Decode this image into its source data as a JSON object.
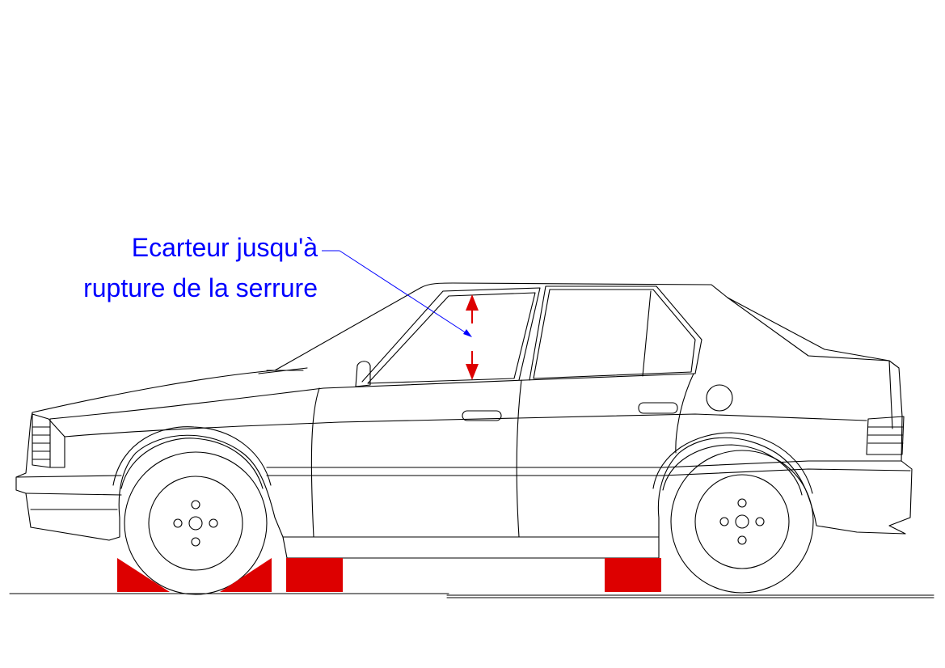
{
  "annotation": {
    "line1": "Ecarteur jusqu'à",
    "line2": "rupture de la serrure"
  },
  "colors": {
    "drawing": "#000000",
    "annotation_text": "#0000ff",
    "highlight": "#dd0000"
  },
  "icons": {
    "up": "arrow-up-icon",
    "down": "arrow-down-icon"
  }
}
